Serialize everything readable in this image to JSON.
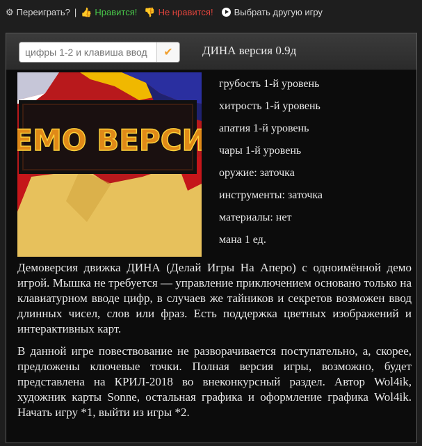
{
  "topbar": {
    "replay_label": "Переиграть?",
    "separator": "|",
    "like_label": "Нравится!",
    "dislike_label": "Не нравится!",
    "choose_label": "Выбрать другую игру"
  },
  "command_input": {
    "placeholder": "цифры 1-2 и клавиша ввод"
  },
  "game_title": "ДИНА версия 0.9д",
  "art": {
    "caption": "ДЕМО ВЕРСИЯ"
  },
  "stats": [
    "грубость 1-й уровень",
    "хитрость 1-й уровень",
    "апатия 1-й уровень",
    "чары 1-й уровень",
    "оружие: заточка",
    "инструменты: заточка",
    "материалы: нет",
    "мана 1 ед."
  ],
  "description": {
    "p1": "Демоверсия движка ДИНА (Делай Игры На Аперо) с одноимённой демо игрой. Мышка не требуется — управление приключением основано только на клавиатурном вводе цифр, в случаев же тайников и секретов возможен ввод длинных чисел, слов или фраз. Есть поддержка цветных изображений и интерактивных карт.",
    "p2": "В данной игре повествование не разворачивается поступательно, а, скорее, предложены ключевые точки. Полная версия игры, возможно, будет представлена на КРИЛ-2018 во внеконкурсный раздел. Автор Wol4ik, художник карты Sonne, остальная графика и оформление графика Wol4ik. Начать игру *1, выйти из игры *2."
  },
  "colors": {
    "like": "#49c94a",
    "dislike": "#e0443c",
    "accent": "#f0a030",
    "background": "#1e1e1e"
  }
}
